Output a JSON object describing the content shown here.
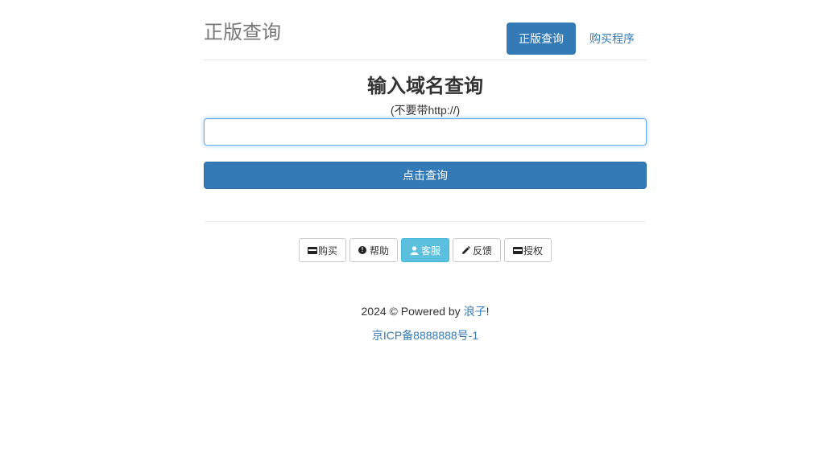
{
  "header": {
    "brand": "正版查询",
    "nav": [
      {
        "label": "正版查询",
        "active": true
      },
      {
        "label": "购买程序",
        "active": false
      }
    ]
  },
  "main": {
    "title": "输入域名查询",
    "hint": "(不要带http://)",
    "input_value": "",
    "input_placeholder": "",
    "submit_label": "点击查询"
  },
  "buttons": [
    {
      "label": "购买",
      "icon": "credit-card-icon"
    },
    {
      "label": "帮助",
      "icon": "exclamation-circle-icon"
    },
    {
      "label": "客服",
      "icon": "user-icon"
    },
    {
      "label": "反馈",
      "icon": "pencil-icon"
    },
    {
      "label": "授权",
      "icon": "credit-card-icon"
    }
  ],
  "footer": {
    "copyright_prefix": "2024 © Powered by ",
    "author": "浪子",
    "copyright_suffix": "!",
    "icp": "京ICP备8888888号-1"
  },
  "colors": {
    "primary": "#337ab7",
    "info": "#5bc0de",
    "brand_text": "#777777"
  }
}
